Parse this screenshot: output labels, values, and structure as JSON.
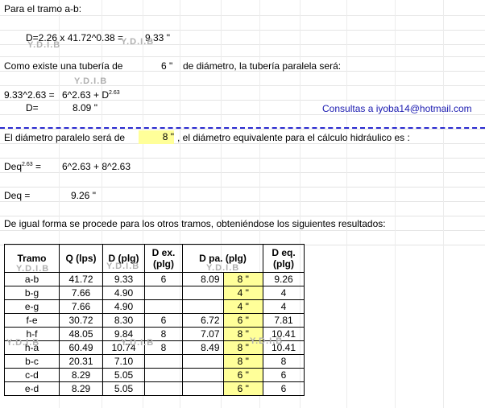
{
  "texts": {
    "line1": "Para el tramo a-b:",
    "formula1": "D=2.26 x 41.72^0.38 =",
    "result1": "9.33 \"",
    "line_existe": "Como existe una tubería de",
    "existe_size": "6 \"",
    "existe_rest": "de diámetro, la tubería paralela será:",
    "eq2_left": "9.33^2.63 =",
    "eq2_right": "6^2.63 + D",
    "eq2_exp": "2.63",
    "d_label": "D=",
    "d_value": "8.09 \"",
    "consultas": "Consultas a iyoba14@hotmail.com",
    "paralelo_pre": "El diámetro paralelo será de",
    "paralelo_size": "8 \"",
    "paralelo_post": ", el diámetro equivalente para el cálculo hidráulico es :",
    "deq_label": "Deq",
    "deq_exp": "2.63",
    "deq_eq": " =",
    "deq_formula": "6^2.63 + 8^2.63",
    "deq2_label": "Deq =",
    "deq2_value": "9.26 \"",
    "igual_forma": "De igual forma se procede para los otros tramos, obteniéndose los siguientes resultados:"
  },
  "watermark": "Y.D.I.B",
  "table": {
    "headers": {
      "tramo": "Tramo",
      "q": "Q (lps)",
      "d": "D (plg)",
      "dex": "D ex. (plg)",
      "dpa": "D pa. (plg)",
      "deq": "D eq. (plg)"
    },
    "rows": [
      {
        "tramo": "a-b",
        "q": "41.72",
        "d": "9.33",
        "dex": "6",
        "dpa_calc": "8.09",
        "dpa": "8 \"",
        "deq": "9.26"
      },
      {
        "tramo": "b-g",
        "q": "7.66",
        "d": "4.90",
        "dex": "",
        "dpa_calc": "",
        "dpa": "4 \"",
        "deq": "4"
      },
      {
        "tramo": "e-g",
        "q": "7.66",
        "d": "4.90",
        "dex": "",
        "dpa_calc": "",
        "dpa": "4 \"",
        "deq": "4"
      },
      {
        "tramo": "f-e",
        "q": "30.72",
        "d": "8.30",
        "dex": "6",
        "dpa_calc": "6.72",
        "dpa": "6 \"",
        "deq": "7.81"
      },
      {
        "tramo": "h-f",
        "q": "48.05",
        "d": "9.84",
        "dex": "8",
        "dpa_calc": "7.07",
        "dpa": "8 \"",
        "deq": "10.41"
      },
      {
        "tramo": "h-a",
        "q": "60.49",
        "d": "10.74",
        "dex": "8",
        "dpa_calc": "8.49",
        "dpa": "8 \"",
        "deq": "10.41"
      },
      {
        "tramo": "b-c",
        "q": "20.31",
        "d": "7.10",
        "dex": "",
        "dpa_calc": "",
        "dpa": "8 \"",
        "deq": "8"
      },
      {
        "tramo": "c-d",
        "q": "8.29",
        "d": "5.05",
        "dex": "",
        "dpa_calc": "",
        "dpa": "6 \"",
        "deq": "6"
      },
      {
        "tramo": "e-d",
        "q": "8.29",
        "d": "5.05",
        "dex": "",
        "dpa_calc": "",
        "dpa": "6 \"",
        "deq": "6"
      }
    ]
  },
  "colors": {
    "highlight": "#ffff99",
    "email": "#1a1ab0",
    "dashed_separator": "#2b2bd0",
    "watermark": "#b0b0b0"
  }
}
